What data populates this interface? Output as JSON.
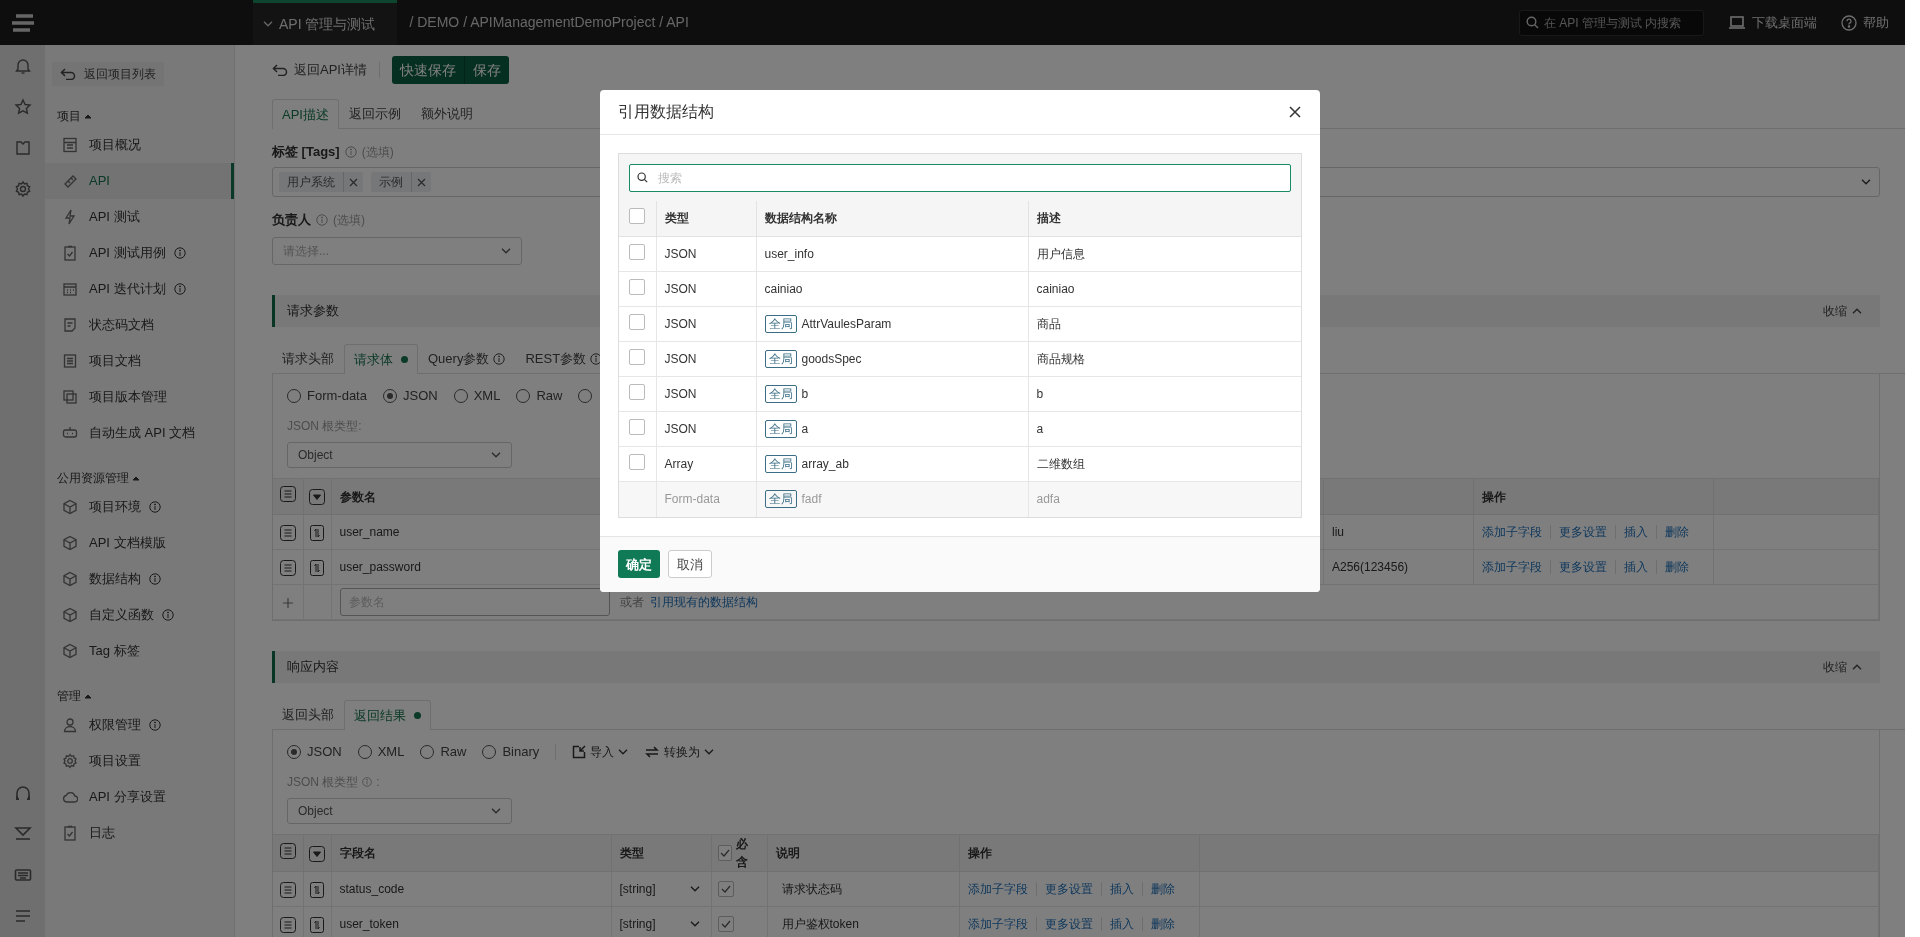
{
  "top_bar": {
    "product_menu": "API 管理与测试",
    "breadcrumb": "/ DEMO / APIManagementDemoProject / API",
    "search_placeholder": "在 API 管理与测试 内搜索",
    "download": "下载桌面端",
    "help": "帮助"
  },
  "sidebar": {
    "back": "返回项目列表",
    "groups": [
      {
        "title": "项目",
        "expanded": true,
        "items": [
          {
            "label": "项目概况",
            "info": false,
            "selected": false
          },
          {
            "label": "API",
            "info": false,
            "selected": true
          },
          {
            "label": "API 测试",
            "info": false,
            "selected": false
          },
          {
            "label": "API 测试用例",
            "info": true,
            "selected": false
          },
          {
            "label": "API 迭代计划",
            "info": true,
            "selected": false
          },
          {
            "label": "状态码文档",
            "info": false,
            "selected": false
          },
          {
            "label": "项目文档",
            "info": false,
            "selected": false
          },
          {
            "label": "项目版本管理",
            "info": false,
            "selected": false
          },
          {
            "label": "自动生成 API 文档",
            "info": false,
            "selected": false
          }
        ]
      },
      {
        "title": "公用资源管理",
        "expanded": true,
        "items": [
          {
            "label": "项目环境",
            "info": true,
            "selected": false
          },
          {
            "label": "API 文档模版",
            "info": false,
            "selected": false
          },
          {
            "label": "数据结构",
            "info": true,
            "selected": false
          },
          {
            "label": "自定义函数",
            "info": true,
            "selected": false
          },
          {
            "label": "Tag 标签",
            "info": false,
            "selected": false
          }
        ]
      },
      {
        "title": "管理",
        "expanded": true,
        "items": [
          {
            "label": "权限管理",
            "info": true,
            "selected": false
          },
          {
            "label": "项目设置",
            "info": false,
            "selected": false
          },
          {
            "label": "API 分享设置",
            "info": false,
            "selected": false
          },
          {
            "label": "日志",
            "info": false,
            "selected": false
          }
        ]
      }
    ]
  },
  "toolbar": {
    "back": "返回API详情",
    "quick_save": "快速保存",
    "save": "保存"
  },
  "doc_tabs": [
    {
      "label": "API描述",
      "selected": true
    },
    {
      "label": "返回示例",
      "selected": false
    },
    {
      "label": "额外说明",
      "selected": false
    }
  ],
  "tags_field": {
    "label": "标签 [Tags]",
    "hint": "(选填)",
    "tags": [
      "用户系统",
      "示例"
    ]
  },
  "owner_field": {
    "label": "负责人",
    "hint": "(选填)",
    "placeholder": "请选择..."
  },
  "request": {
    "title": "请求参数",
    "collapse": "收缩",
    "tabs": [
      {
        "label": "请求头部",
        "selected": false,
        "dot": false,
        "info": false
      },
      {
        "label": "请求体",
        "selected": true,
        "dot": true,
        "info": false
      },
      {
        "label": "Query参数",
        "selected": false,
        "dot": false,
        "info": true
      },
      {
        "label": "REST参数",
        "selected": false,
        "dot": false,
        "info": true
      }
    ],
    "body_types": [
      {
        "label": "Form-data",
        "selected": false
      },
      {
        "label": "JSON",
        "selected": true
      },
      {
        "label": "XML",
        "selected": false
      },
      {
        "label": "Raw",
        "selected": false
      },
      {
        "selected": false
      }
    ],
    "root_type": {
      "label": "JSON 根类型:",
      "info": false,
      "value": "Object"
    },
    "table": {
      "name_column": "参数名",
      "action_column": "操作",
      "rows": [
        {
          "name": "user_name",
          "value": "liu",
          "actions": [
            "添加子字段",
            "更多设置",
            "插入",
            "删除"
          ]
        },
        {
          "name": "user_password",
          "value": "A256(123456)",
          "actions": [
            "添加子字段",
            "更多设置",
            "插入",
            "删除"
          ]
        }
      ],
      "add_row": {
        "placeholder": "参数名",
        "or_text": "或者",
        "link": "引用现有的数据结构"
      }
    }
  },
  "response": {
    "title": "响应内容",
    "collapse": "收缩",
    "tabs": [
      {
        "label": "返回头部",
        "selected": false,
        "dot": false,
        "info": false
      },
      {
        "label": "返回结果",
        "selected": true,
        "dot": true,
        "info": false
      }
    ],
    "body_types": [
      {
        "label": "JSON",
        "selected": true
      },
      {
        "label": "XML",
        "selected": false
      },
      {
        "label": "Raw",
        "selected": false
      },
      {
        "label": "Binary",
        "selected": false
      }
    ],
    "tools": [
      {
        "label": "导入",
        "kind": "import"
      },
      {
        "label": "转换为",
        "kind": "convert"
      }
    ],
    "root_type": {
      "label": "JSON 根类型",
      "info": true,
      "suffix": ":",
      "value": "Object"
    },
    "table": {
      "columns": [
        "字段名",
        "类型",
        "必含",
        "说明",
        "操作"
      ],
      "required_all": true,
      "rows": [
        {
          "name": "status_code",
          "type": "[string]",
          "required": true,
          "description": "请求状态码",
          "actions": [
            "添加子字段",
            "更多设置",
            "插入",
            "删除"
          ]
        },
        {
          "name": "user_token",
          "type": "[string]",
          "required": true,
          "description": "用户鉴权token",
          "actions": [
            "添加子字段",
            "更多设置",
            "插入",
            "删除"
          ]
        }
      ]
    }
  },
  "modal": {
    "title": "引用数据结构",
    "search_placeholder": "搜索",
    "columns": [
      "类型",
      "数据结构名称",
      "描述"
    ],
    "select_all": false,
    "rows": [
      {
        "type": "JSON",
        "name": "user_info",
        "description": "用户信息",
        "checked": false,
        "disabled": false
      },
      {
        "type": "JSON",
        "name": "cainiao",
        "description": "cainiao",
        "checked": false,
        "disabled": false
      },
      {
        "type": "JSON",
        "badge": "全局",
        "name": "AttrVaulesParam",
        "description": "商品",
        "checked": false,
        "disabled": false
      },
      {
        "type": "JSON",
        "badge": "全局",
        "name": "goodsSpec",
        "description": "商品规格",
        "checked": false,
        "disabled": false
      },
      {
        "type": "JSON",
        "badge": "全局",
        "name": "b",
        "description": "b",
        "checked": false,
        "disabled": false
      },
      {
        "type": "JSON",
        "badge": "全局",
        "name": "a",
        "description": "a",
        "checked": false,
        "disabled": false
      },
      {
        "type": "Array",
        "badge": "全局",
        "name": "array_ab",
        "description": "二维数组",
        "checked": false,
        "disabled": false
      },
      {
        "type": "Form-data",
        "badge": "全局",
        "name": "fadf",
        "description": "adfa",
        "disabled": true
      }
    ],
    "ok": "确定",
    "cancel": "取消"
  }
}
